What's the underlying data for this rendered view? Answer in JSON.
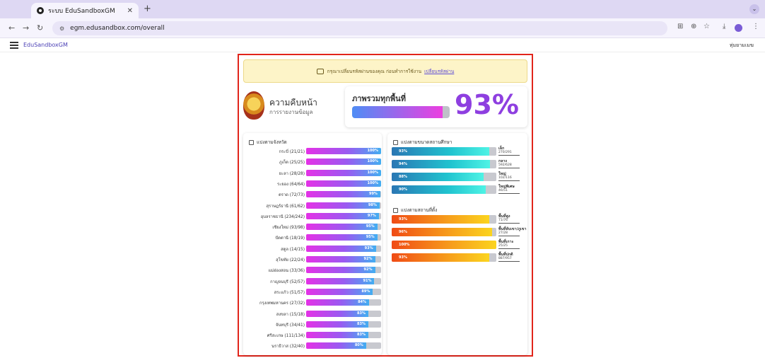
{
  "browser": {
    "tab_title": "ระบบ EduSandboxGM",
    "url": "egm.edusandbox.com/overall"
  },
  "app": {
    "brand": "EduSandboxGM",
    "user": "ทุ่มยามเมฆ"
  },
  "notice": {
    "text": "กรุณาเปลี่ยนรหัสผ่านของคุณ ก่อนทำการใช้งาน",
    "link": "เปลี่ยนรหัสผ่าน"
  },
  "progress": {
    "title": "ความคืบหน้า",
    "subtitle": "การรายงานข้อมูล"
  },
  "overall": {
    "label": "ภาพรวมทุกพื้นที่",
    "percent": 93,
    "percent_text": "93%"
  },
  "provinces": {
    "heading": "แบ่งตามจังหวัด",
    "items": [
      {
        "label": "กระบี่ (21/21)",
        "pct": 100,
        "pct_text": "100%"
      },
      {
        "label": "ภูเก็ต (25/25)",
        "pct": 100,
        "pct_text": "100%"
      },
      {
        "label": "ยะลา (28/28)",
        "pct": 100,
        "pct_text": "100%"
      },
      {
        "label": "ระยอง (64/64)",
        "pct": 100,
        "pct_text": "100%"
      },
      {
        "label": "ตราด (72/73)",
        "pct": 99,
        "pct_text": "99%"
      },
      {
        "label": "สุราษฎร์ธานี (61/62)",
        "pct": 98,
        "pct_text": "98%"
      },
      {
        "label": "อุบลราชธานี (234/242)",
        "pct": 97,
        "pct_text": "97%"
      },
      {
        "label": "เชียงใหม่ (93/98)",
        "pct": 95,
        "pct_text": "95%"
      },
      {
        "label": "ปัตตานี (18/19)",
        "pct": 95,
        "pct_text": "95%"
      },
      {
        "label": "สตูล (14/15)",
        "pct": 93,
        "pct_text": "93%"
      },
      {
        "label": "สุโขทัย (22/24)",
        "pct": 92,
        "pct_text": "92%"
      },
      {
        "label": "แม่ฮ่องสอน (33/36)",
        "pct": 92,
        "pct_text": "92%"
      },
      {
        "label": "กาญจนบุรี (52/57)",
        "pct": 91,
        "pct_text": "91%"
      },
      {
        "label": "สระแก้ว (51/57)",
        "pct": 89,
        "pct_text": "89%"
      },
      {
        "label": "กรุงเทพมหานคร (27/32)",
        "pct": 84,
        "pct_text": "84%"
      },
      {
        "label": "สงขลา (15/18)",
        "pct": 83,
        "pct_text": "83%"
      },
      {
        "label": "จันทบุรี (34/41)",
        "pct": 83,
        "pct_text": "83%"
      },
      {
        "label": "ศรีสะเกษ (111/134)",
        "pct": 83,
        "pct_text": "83%"
      },
      {
        "label": "นราธิวาส (32/40)",
        "pct": 80,
        "pct_text": "80%"
      }
    ]
  },
  "school_size": {
    "heading": "แบ่งตามขนาดสถานศึกษา",
    "items": [
      {
        "name": "เล็ก",
        "count": "270/291",
        "pct": 93,
        "pct_text": "93%"
      },
      {
        "name": "กลาง",
        "count": "592/628",
        "pct": 94,
        "pct_text": "94%"
      },
      {
        "name": "ใหญ่",
        "count": "102/116",
        "pct": 88,
        "pct_text": "88%"
      },
      {
        "name": "ใหญ่พิเศษ",
        "count": "46/51",
        "pct": 90,
        "pct_text": "90%"
      }
    ]
  },
  "location": {
    "heading": "แบ่งตามสถานที่ตั้ง",
    "items": [
      {
        "name": "พื้นที่สูง",
        "count": "71/76",
        "pct": 93,
        "pct_text": "93%"
      },
      {
        "name": "พื้นที่ลับเขา/ภูเขา",
        "count": "27/28",
        "pct": 96,
        "pct_text": "96%"
      },
      {
        "name": "พื้นที่เกาะ",
        "count": "25/25",
        "pct": 100,
        "pct_text": "100%"
      },
      {
        "name": "พื้นที่ปกติ",
        "count": "887/957",
        "pct": 93,
        "pct_text": "93%"
      }
    ]
  }
}
